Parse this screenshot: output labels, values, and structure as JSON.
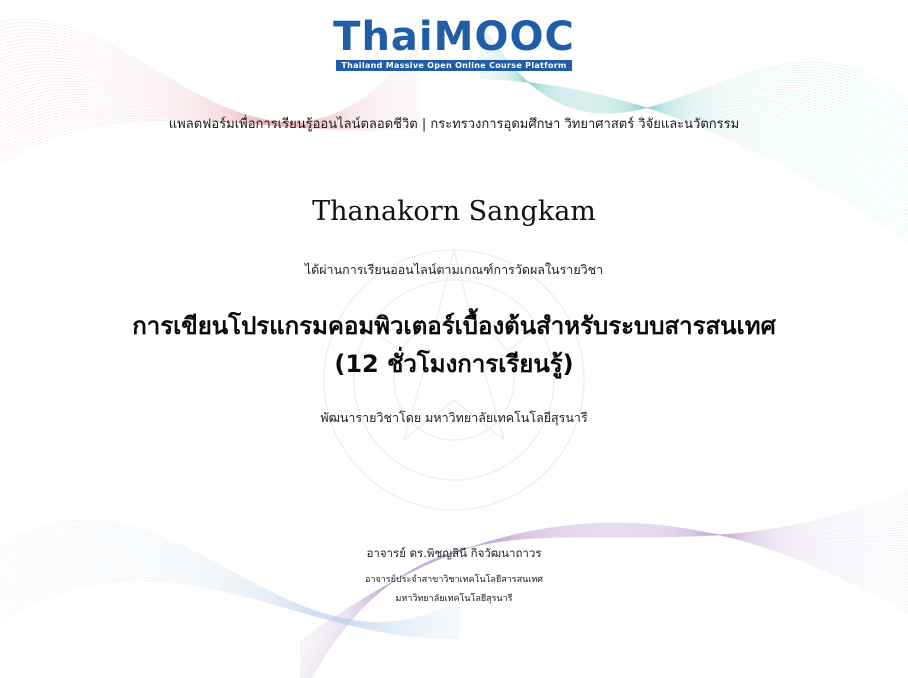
{
  "logo": {
    "brand_prefix": "Thai",
    "brand_suffix": "MOOC",
    "tagline": "Thailand Massive Open Online Course Platform"
  },
  "header": {
    "platform_line": "แพลตฟอร์มเพื่อการเรียนรู้ออนไลน์ตลอดชีวิต | กระทรวงการอุดมศึกษา วิทยาศาสตร์ วิจัยและนวัตกรรม"
  },
  "certificate": {
    "recipient_name": "Thanakorn Sangkam",
    "passed_statement": "ได้ผ่านการเรียนออนไลน์ตามเกณฑ์การวัดผลในรายวิชา",
    "course_title_line1": "การเขียนโปรแกรมคอมพิวเตอร์เบื้องต้นสำหรับระบบสารสนเทศ",
    "course_title_line2": "(12 ชั่วโมงการเรียนรู้)",
    "developer_line": "พัฒนารายวิชาโดย มหาวิทยาลัยเทคโนโลยีสุรนารี"
  },
  "signatory": {
    "name": "อาจารย์ ดร.พิชญสินี กิจวัฒนาถาวร",
    "position": "อาจารย์ประจำสาขาวิชาเทคโนโลยีสารสนเทศ",
    "organization": "มหาวิทยาลัยเทคโนโลยีสุรนารี"
  },
  "colors": {
    "brand_blue": "#1f5da8",
    "brand_green": "#3ec6a8",
    "text": "#111111"
  }
}
